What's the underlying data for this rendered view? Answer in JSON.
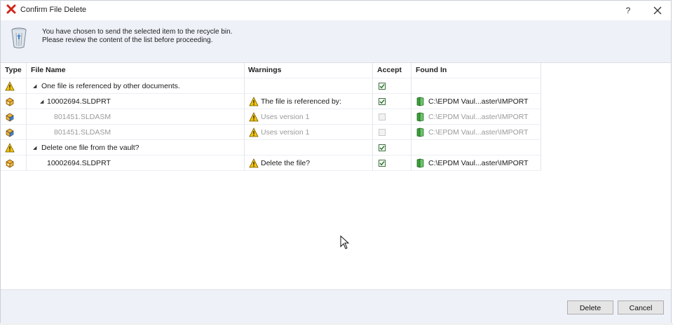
{
  "window": {
    "title": "Confirm File Delete",
    "help_label": "?",
    "icon": "red-x-icon"
  },
  "info": {
    "line1": "You have chosen to send the selected item to the recycle bin.",
    "line2": "Please review the content of the list before proceeding.",
    "icon": "recycle-bin-icon"
  },
  "columns": [
    "Type",
    "File Name",
    "Warnings",
    "Accept",
    "Found In"
  ],
  "rows": [
    {
      "type_icon": "warning-icon",
      "expander": "◢",
      "name": "One file is referenced by other documents.",
      "warning": "",
      "accept": true,
      "accept_enabled": true,
      "found": "",
      "dim": false
    },
    {
      "type_icon": "part-icon",
      "expander": "◢",
      "name": "10002694.SLDPRT",
      "warning": "The file is referenced by:",
      "accept": true,
      "accept_enabled": true,
      "found": "C:\\EPDM Vaul...aster\\IMPORT",
      "dim": false
    },
    {
      "type_icon": "assembly-icon",
      "expander": "",
      "name": "801451.SLDASM",
      "warning": "Uses version 1",
      "accept": false,
      "accept_enabled": false,
      "found": "C:\\EPDM Vaul...aster\\IMPORT",
      "dim": true
    },
    {
      "type_icon": "assembly-icon",
      "expander": "",
      "name": "801451.SLDASM",
      "warning": "Uses version 1",
      "accept": false,
      "accept_enabled": false,
      "found": "C:\\EPDM Vaul...aster\\IMPORT",
      "dim": true
    },
    {
      "type_icon": "warning-icon",
      "expander": "◢",
      "name": "Delete one file from the vault?",
      "warning": "",
      "accept": true,
      "accept_enabled": true,
      "found": "",
      "dim": false
    },
    {
      "type_icon": "part-icon",
      "expander": "",
      "name": "10002694.SLDPRT",
      "warning": "Delete the file?",
      "accept": true,
      "accept_enabled": true,
      "found": "C:\\EPDM Vaul...aster\\IMPORT",
      "dim": false
    }
  ],
  "buttons": {
    "delete": "Delete",
    "cancel": "Cancel"
  }
}
